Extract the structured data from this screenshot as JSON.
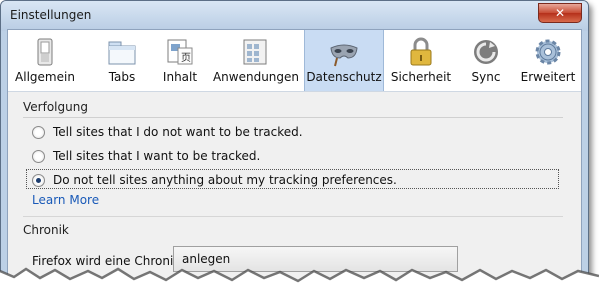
{
  "window": {
    "title": "Einstellungen",
    "close_glyph": "✕"
  },
  "toolbar": {
    "items": [
      {
        "label": "Allgemein",
        "icon": "switch-icon"
      },
      {
        "label": "Tabs",
        "icon": "tabs-window-icon"
      },
      {
        "label": "Inhalt",
        "icon": "content-page-icon"
      },
      {
        "label": "Anwendungen",
        "icon": "applications-icon"
      },
      {
        "label": "Datenschutz",
        "icon": "privacy-mask-icon",
        "active": true
      },
      {
        "label": "Sicherheit",
        "icon": "padlock-icon"
      },
      {
        "label": "Sync",
        "icon": "sync-icon"
      },
      {
        "label": "Erweitert",
        "icon": "gear-icon"
      }
    ]
  },
  "tracking": {
    "title": "Verfolgung",
    "options": [
      {
        "label": "Tell sites that I do not want to be tracked.",
        "checked": false
      },
      {
        "label": "Tell sites that I want to be tracked.",
        "checked": false
      },
      {
        "label": "Do not tell sites anything about my tracking preferences.",
        "checked": true
      }
    ],
    "learn_more": "Learn More"
  },
  "history": {
    "title": "Chronik",
    "label": "Firefox wird eine Chronik:",
    "value": "anlegen"
  },
  "colors": {
    "active_tab": "#c9dcf3",
    "link": "#1a5ab8",
    "frame": "#bcd0e6"
  }
}
